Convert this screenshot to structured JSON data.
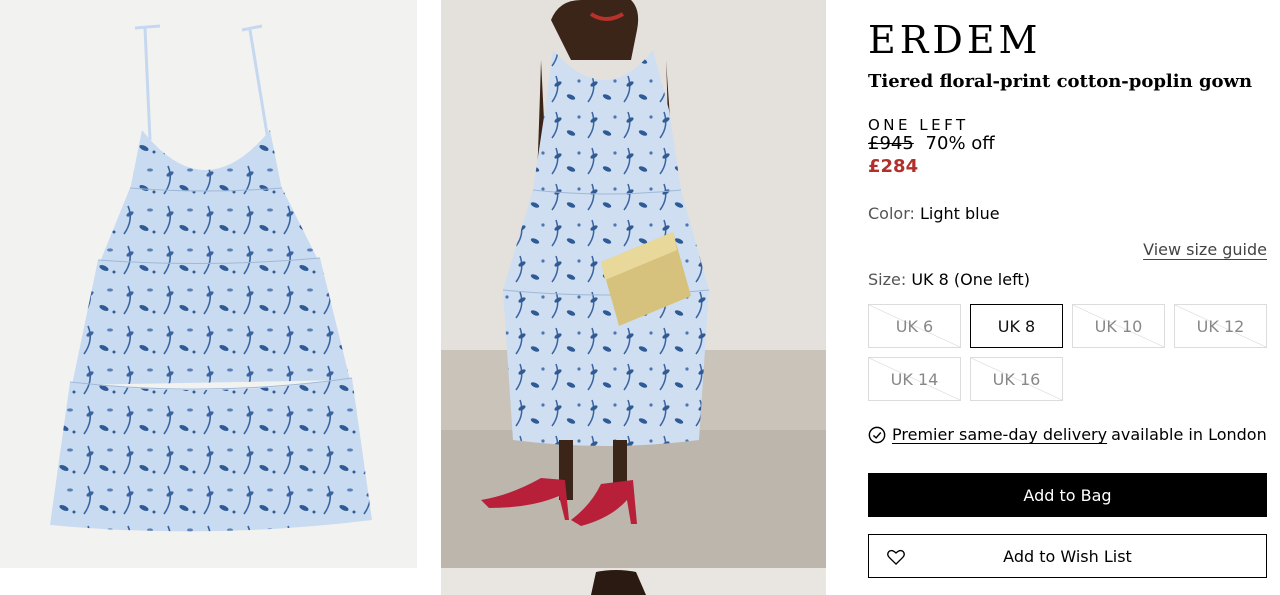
{
  "product": {
    "brand": "ERDEM",
    "name": "Tiered floral-print cotton-poplin gown",
    "stock_label": "ONE LEFT",
    "price_original": "£945",
    "discount": "70% off",
    "price_sale": "£284",
    "color_label": "Color:",
    "color_value": "Light blue",
    "size_guide_link": "View size guide",
    "size_label": "Size:",
    "size_value": "UK 8 (One left)"
  },
  "sizes": [
    {
      "label": "UK 6",
      "state": "unavailable"
    },
    {
      "label": "UK 8",
      "state": "selected"
    },
    {
      "label": "UK 10",
      "state": "unavailable"
    },
    {
      "label": "UK 12",
      "state": "unavailable"
    },
    {
      "label": "UK 14",
      "state": "unavailable"
    },
    {
      "label": "UK 16",
      "state": "unavailable"
    }
  ],
  "delivery": {
    "icon": "check-circle-icon",
    "link_text": "Premier same-day delivery",
    "suffix": "available in London"
  },
  "actions": {
    "add_to_bag": "Add to Bag",
    "add_to_wishlist": "Add to Wish List",
    "wishlist_icon": "heart-outline-icon"
  },
  "colors": {
    "sale_price": "#b0302c",
    "primary_button": "#000000",
    "dress_light_blue": "#c6d8ef",
    "print_dark_blue": "#2e5a96"
  }
}
